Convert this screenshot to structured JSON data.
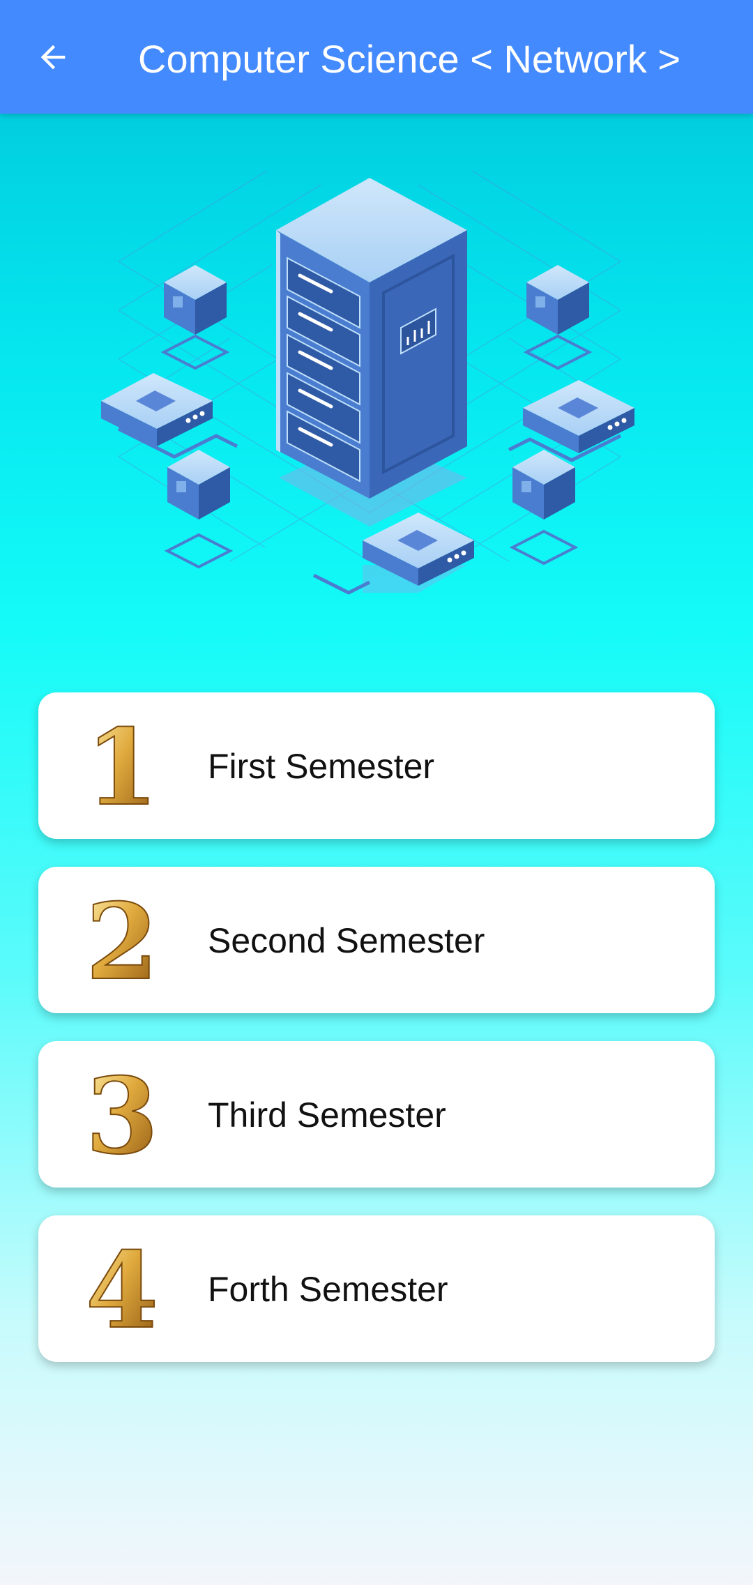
{
  "app_bar": {
    "title": "Computer Science < Network >",
    "back_icon": "arrow-left-icon",
    "color": "#448aff"
  },
  "hero": {
    "icon": "server-network-illustration"
  },
  "semesters": [
    {
      "number": "1",
      "label": "First Semester"
    },
    {
      "number": "2",
      "label": "Second Semester"
    },
    {
      "number": "3",
      "label": "Third Semester"
    },
    {
      "number": "4",
      "label": "Forth Semester"
    }
  ],
  "colors": {
    "background_top": "#00c3d8",
    "background_bottom": "#f3f6fb",
    "card": "#ffffff",
    "number_gold": "#d9a43a"
  }
}
